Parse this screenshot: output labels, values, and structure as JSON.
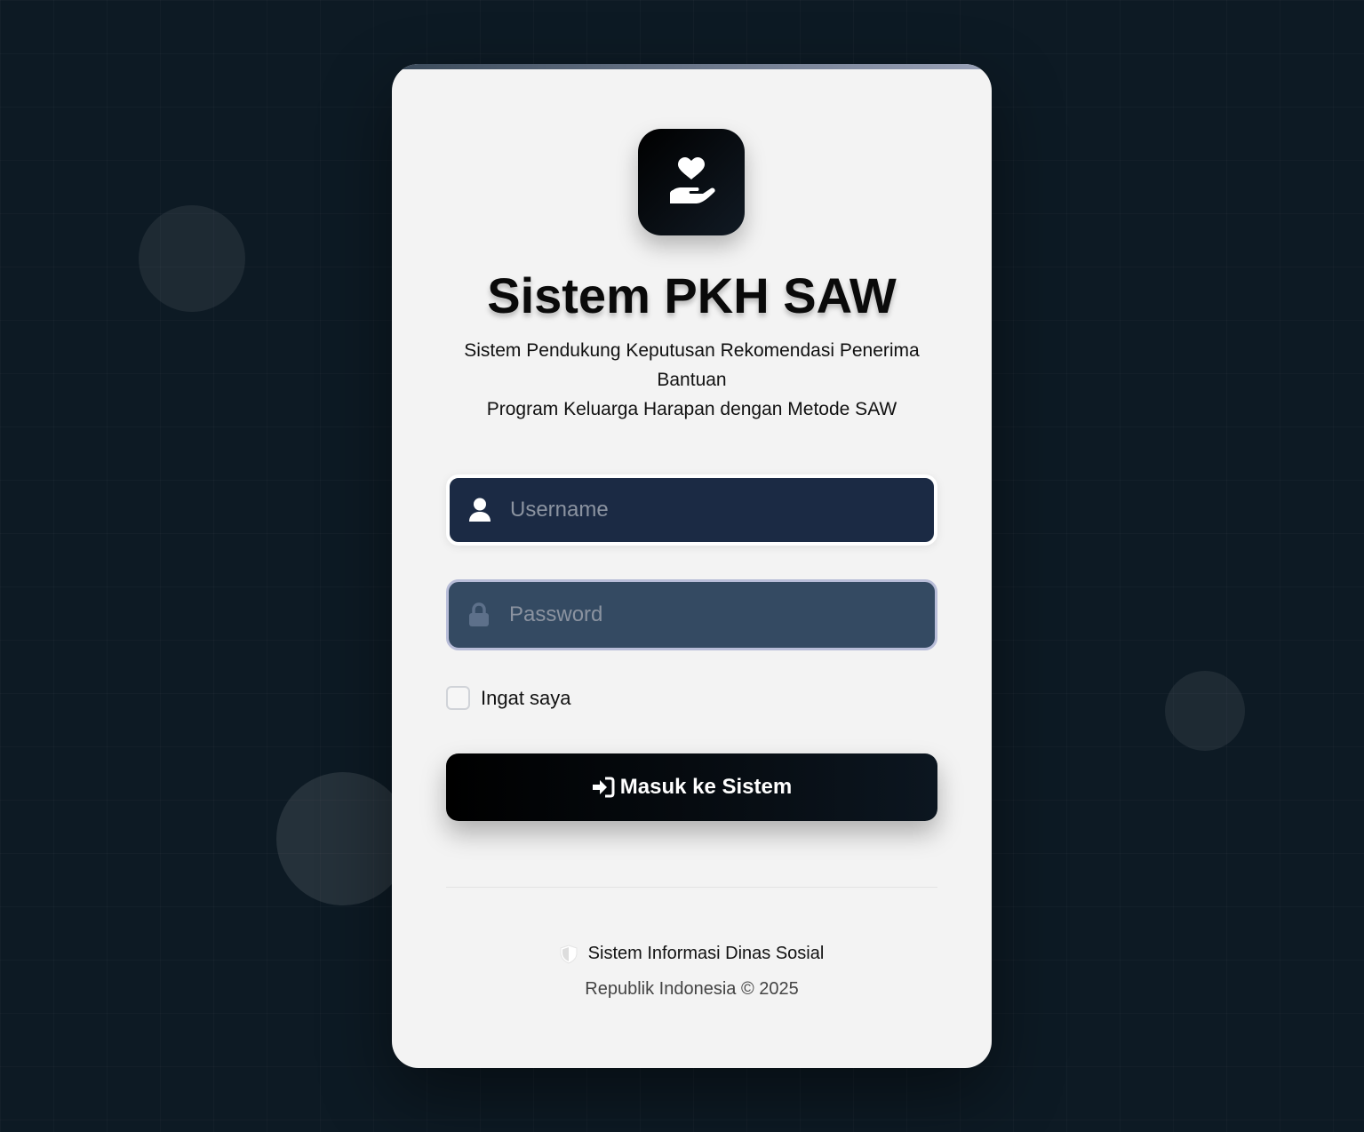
{
  "app": {
    "title": "Sistem PKH SAW",
    "subtitle_line1": "Sistem Pendukung Keputusan Rekomendasi Penerima Bantuan",
    "subtitle_line2": "Program Keluarga Harapan dengan Metode SAW",
    "logo_icon": "hand-holding-heart-icon"
  },
  "form": {
    "username": {
      "placeholder": "Username",
      "value": "",
      "icon": "user-icon"
    },
    "password": {
      "placeholder": "Password",
      "value": "",
      "icon": "lock-icon"
    },
    "remember_label": "Ingat saya",
    "remember_checked": false,
    "submit_label": "Masuk ke Sistem",
    "submit_icon": "sign-in-icon"
  },
  "footer": {
    "org_icon": "shield-icon",
    "org_label": "Sistem Informasi Dinas Sosial",
    "copyright": "Republik Indonesia © 2025"
  },
  "colors": {
    "background": "#0d1a24",
    "card": "#f3f3f3",
    "username_field": "#1b2a44",
    "password_field": "#344a62",
    "button": "#000000"
  }
}
